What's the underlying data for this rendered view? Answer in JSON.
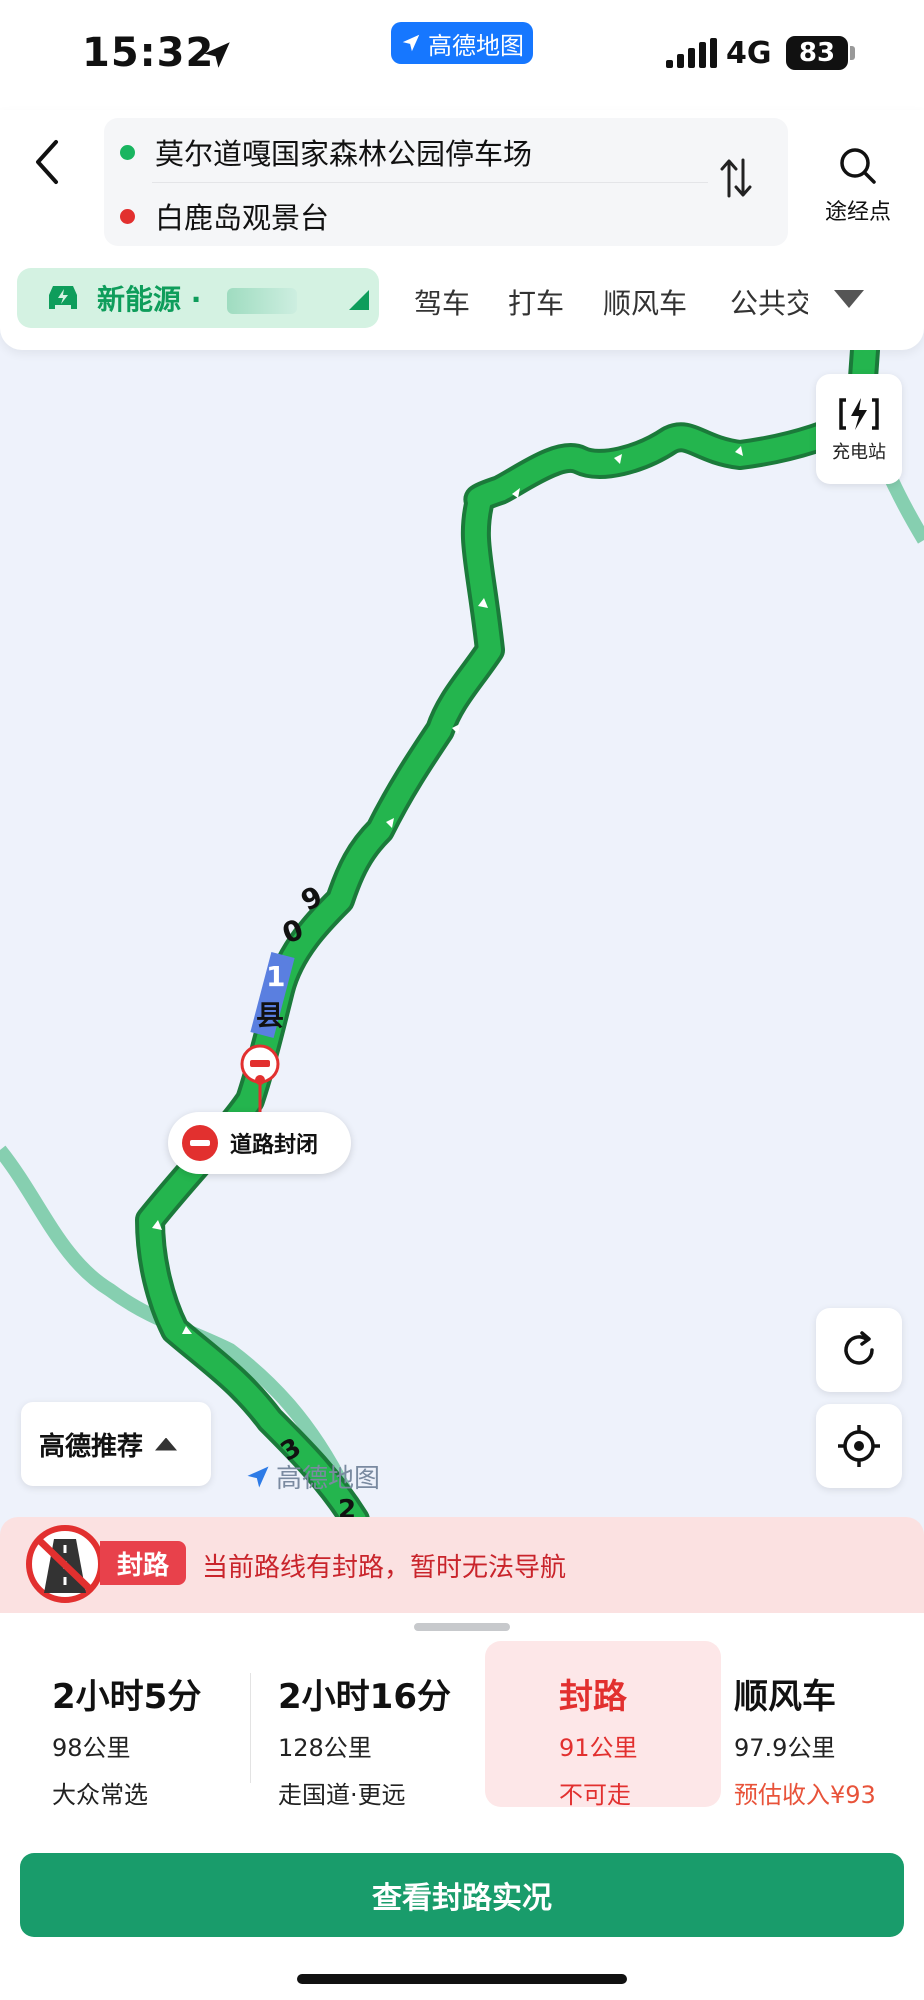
{
  "status_bar": {
    "time": "15:32",
    "app_badge": "高德地图",
    "network": "4G",
    "battery": "83"
  },
  "route": {
    "origin": "莫尔道嘎国家森林公园停车场",
    "destination": "白鹿岛观景台",
    "origin_color": "#19b560",
    "destination_color": "#e2302f",
    "waypoint_label": "途经点"
  },
  "modes": {
    "ev_label": "新能源 ·",
    "items": [
      "驾车",
      "打车",
      "顺风车",
      "公共交"
    ]
  },
  "map": {
    "charge_station_label": "充电站",
    "road_label_chars": [
      "9",
      "0",
      "1",
      "县"
    ],
    "road_label_chars_2": [
      "3",
      "2"
    ],
    "closure_callout": "道路封闭",
    "recommend_label": "高德推荐",
    "watermark": "高德地图",
    "route_color": "#1eb050"
  },
  "banner": {
    "tag": "封路",
    "message": "当前路线有封路，暂时无法导航"
  },
  "options": [
    {
      "title": "2小时5分",
      "distance": "98公里",
      "desc": "大众常选"
    },
    {
      "title": "2小时16分",
      "distance": "128公里",
      "desc": "走国道·更远"
    },
    {
      "title": "封路",
      "distance": "91公里",
      "desc": "不可走"
    },
    {
      "title": "顺风车",
      "distance": "97.9公里",
      "desc": "预估收入¥93"
    }
  ],
  "action_button": "查看封路实况"
}
